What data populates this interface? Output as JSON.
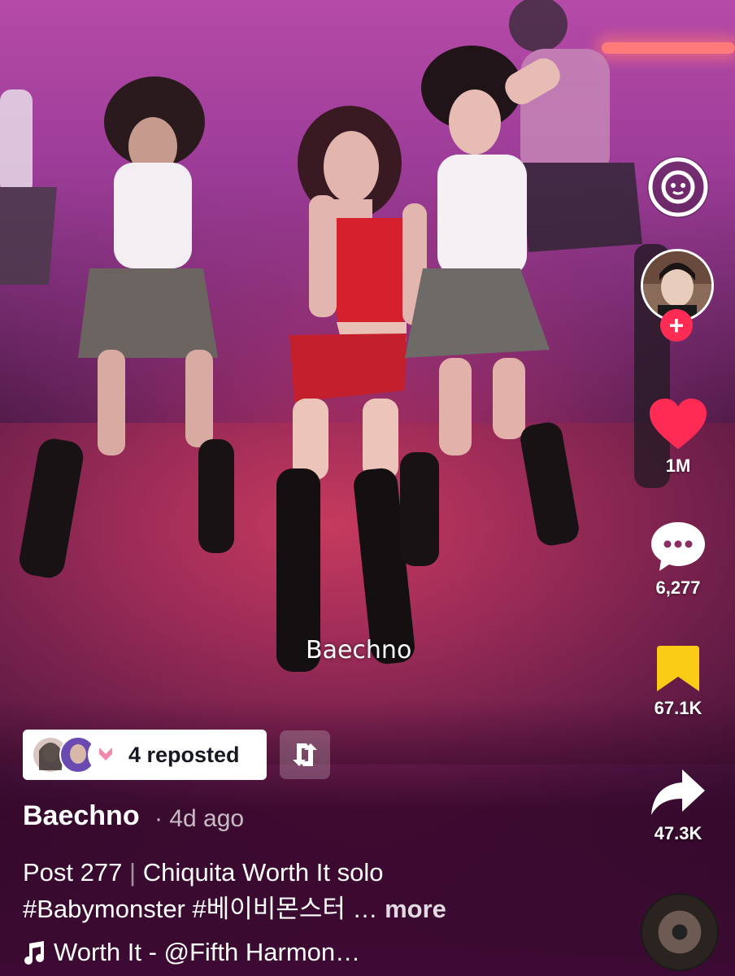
{
  "video": {
    "watermark": "Baechno"
  },
  "actions": {
    "likes": "1M",
    "comments": "6,277",
    "saves": "67.1K",
    "shares": "47.3K",
    "like_color": "#fe2c55",
    "save_color": "#facc15",
    "follow_color": "#fe2c55"
  },
  "repost": {
    "label": "4 reposted"
  },
  "post": {
    "author": "Baechno",
    "age": "4d ago",
    "caption_line1_prefix": "Post 277",
    "caption_line1_separator": "|",
    "caption_line1_rest": "Chiquita Worth It solo",
    "caption_line2": "#Babymonster #베이비몬스터 …",
    "more_label": "more"
  },
  "music": {
    "icon": "music-note-icon",
    "label": "Worth It - @Fifth Harmon…"
  }
}
